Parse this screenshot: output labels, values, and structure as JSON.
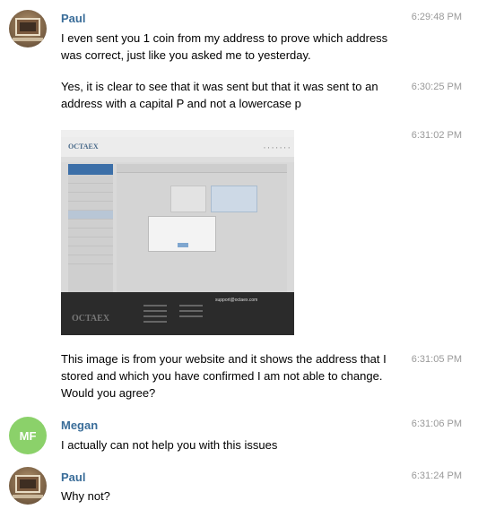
{
  "messages": [
    {
      "sender": "Paul",
      "time": "6:29:48 PM",
      "text": "I even sent you 1 coin from my address to prove which address was correct, just like you asked me to yesterday."
    },
    {
      "time": "6:30:25 PM",
      "text": "Yes, it is clear to see that it was sent but that it was sent to an address with a capital P and not a lowercase p"
    },
    {
      "time": "6:31:02 PM",
      "image": {
        "brand": "OCTAEX",
        "footer_email": "support@octaex.com"
      }
    },
    {
      "time": "6:31:05 PM",
      "text": "This image is from your website and it shows the address that I stored and which you have confirmed I am not able to change. Would you agree?"
    },
    {
      "sender": "Megan",
      "initials": "MF",
      "time": "6:31:06 PM",
      "text": "I actually can not help you with this issues"
    },
    {
      "sender": "Paul",
      "time": "6:31:24 PM",
      "text": "Why not?"
    }
  ],
  "colors": {
    "sender": "#3a6d99",
    "time": "#999999",
    "avatar_mf": "#8bd16a"
  }
}
